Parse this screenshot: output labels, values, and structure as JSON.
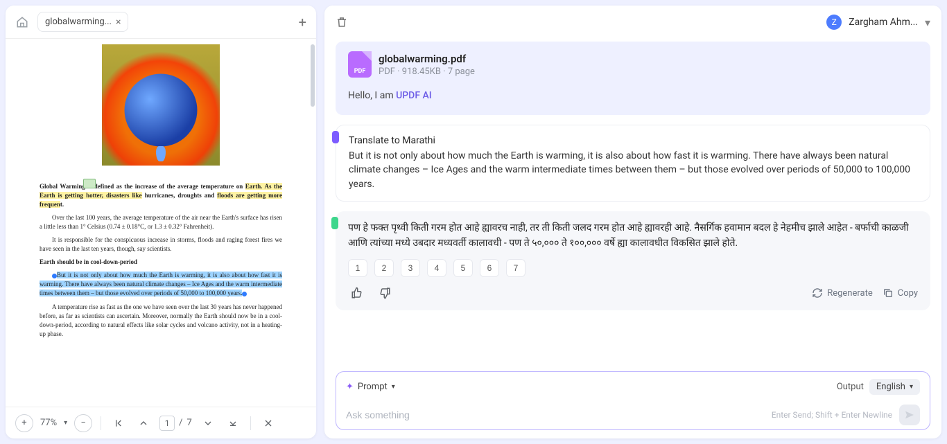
{
  "tabs": {
    "active_title": "globalwarming...",
    "close_glyph": "×",
    "add_glyph": "+"
  },
  "document": {
    "p1_a": "Global Warming is defined as the increase of the average temperature on ",
    "p1_b": "Earth. As the Earth is getting hotter, disasters like",
    "p1_c": " hurricanes, droughts and ",
    "p1_d": "floods are getting more frequen",
    "p1_e": "t.",
    "p2": "Over the last 100 years, the average temperature of the air near the Earth's surface has risen a little less than 1° Celsius (0.74 ± 0.18°C, or 1.3 ± 0.32° Fahrenheit).",
    "p3": "It is responsible for the conspicuous increase in storms, floods and raging forest fires we have seen in the last ten years, though, say scientists.",
    "p4": "Earth should be in cool-down-period",
    "p5_a": "But it is not only about how much the Earth is warming, it is also about how fast it is warming. There have always been natural climate changes – Ice Ages and the warm intermediate times between them – but those evolved over periods of 50,000 to 100,000 years.",
    "p6": "A temperature rise as fast as the one we have seen over the last 30 years has never happened before, as far as scientists can ascertain. Moreover, normally the Earth should now be in a cool-down-period, according to natural effects like solar cycles and volcano activity, not in a heating-up phase."
  },
  "toolbar": {
    "zoom": "77%",
    "page_current": "1",
    "page_sep": "/",
    "page_total": "7",
    "zoom_in_glyph": "+",
    "zoom_out_glyph": "−"
  },
  "header": {
    "user_name": "Zargham Ahm..."
  },
  "chat": {
    "file_name": "globalwarming.pdf",
    "file_meta": "PDF · 918.45KB · 7 page",
    "hello_prefix": "Hello, I am ",
    "hello_link": "UPDF AI",
    "user_title": "Translate to Marathi",
    "user_body": "But it is not only about how much the Earth is warming, it is also about how fast it is warming. There have always been natural climate changes – Ice Ages and the warm intermediate times between them – but those evolved over periods of 50,000 to 100,000 years.",
    "ai_body": "पण हे फक्त पृथ्वी किती गरम होत आहे ह्यावरच नाही, तर ती किती जलद गरम होत आहे ह्यावरही आहे. नैसर्गिक हवामान बदल हे नेहमीच झाले आहेत - बर्फाची काळजी आणि त्यांच्या मध्ये उबदार मध्यवर्ती कालावधी - पण ते ५०,००० ते १००,००० वर्षे ह्या कालावधीत विकसित झाले होते.",
    "pager": [
      "1",
      "2",
      "3",
      "4",
      "5",
      "6",
      "7"
    ],
    "regenerate": "Regenerate",
    "copy": "Copy"
  },
  "composer": {
    "prompt_label": "Prompt",
    "output_label": "Output",
    "language": "English",
    "placeholder": "Ask something",
    "hint": "Enter Send; Shift + Enter Newline"
  }
}
